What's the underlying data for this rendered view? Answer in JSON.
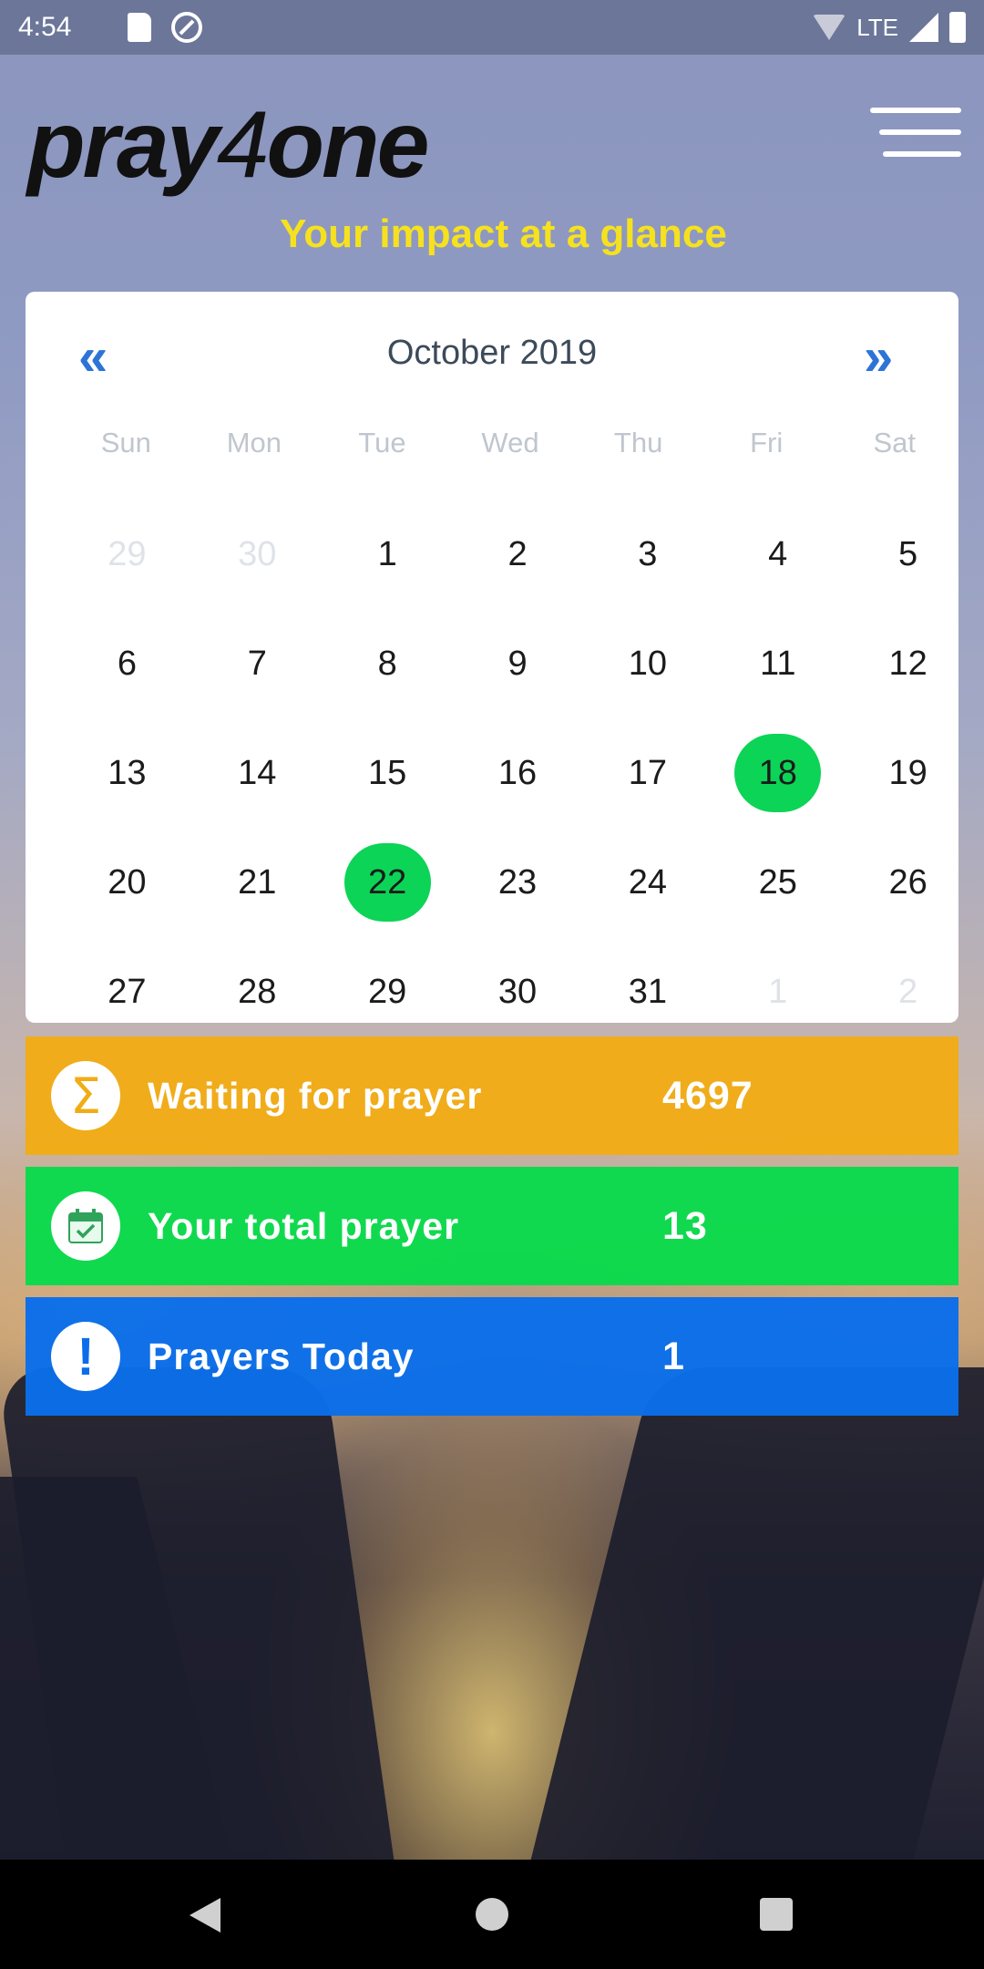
{
  "status_bar": {
    "time": "4:54",
    "network": "LTE",
    "icons": [
      "sd-card-icon",
      "dnd-icon",
      "wifi-off-icon",
      "signal-icon",
      "battery-icon"
    ]
  },
  "header": {
    "logo_part1": "pray",
    "logo_part2": "4",
    "logo_part3": "one",
    "menu_icon": "hamburger-menu-icon",
    "headline": "Your impact at a glance"
  },
  "calendar": {
    "prev_label": "«",
    "next_label": "»",
    "month_title": "October 2019",
    "weekdays": [
      "Sun",
      "Mon",
      "Tue",
      "Wed",
      "Thu",
      "Fri",
      "Sat"
    ],
    "weeks": [
      [
        {
          "d": "29",
          "muted": true
        },
        {
          "d": "30",
          "muted": true
        },
        {
          "d": "1"
        },
        {
          "d": "2"
        },
        {
          "d": "3"
        },
        {
          "d": "4"
        },
        {
          "d": "5"
        }
      ],
      [
        {
          "d": "6"
        },
        {
          "d": "7"
        },
        {
          "d": "8"
        },
        {
          "d": "9"
        },
        {
          "d": "10"
        },
        {
          "d": "11"
        },
        {
          "d": "12"
        }
      ],
      [
        {
          "d": "13"
        },
        {
          "d": "14"
        },
        {
          "d": "15"
        },
        {
          "d": "16"
        },
        {
          "d": "17"
        },
        {
          "d": "18",
          "marked": true
        },
        {
          "d": "19"
        }
      ],
      [
        {
          "d": "20"
        },
        {
          "d": "21"
        },
        {
          "d": "22",
          "marked": true
        },
        {
          "d": "23"
        },
        {
          "d": "24"
        },
        {
          "d": "25"
        },
        {
          "d": "26"
        }
      ],
      [
        {
          "d": "27"
        },
        {
          "d": "28"
        },
        {
          "d": "29"
        },
        {
          "d": "30"
        },
        {
          "d": "31"
        },
        {
          "d": "1",
          "muted": true
        },
        {
          "d": "2",
          "muted": true
        }
      ]
    ],
    "marked_color": "#0cd456"
  },
  "stats": {
    "waiting": {
      "label": "Waiting for prayer",
      "value": "4697",
      "icon": "sigma-icon",
      "color": "#f1ac14"
    },
    "total": {
      "label": "Your total prayer",
      "value": "13",
      "icon": "calendar-check-icon",
      "color": "#08db4c"
    },
    "today": {
      "label": "Prayers Today",
      "value": "1",
      "icon": "exclamation-icon",
      "color": "#0a6eea"
    }
  },
  "nav_bar": {
    "icons": [
      "back-icon",
      "home-icon",
      "recent-apps-icon"
    ]
  }
}
